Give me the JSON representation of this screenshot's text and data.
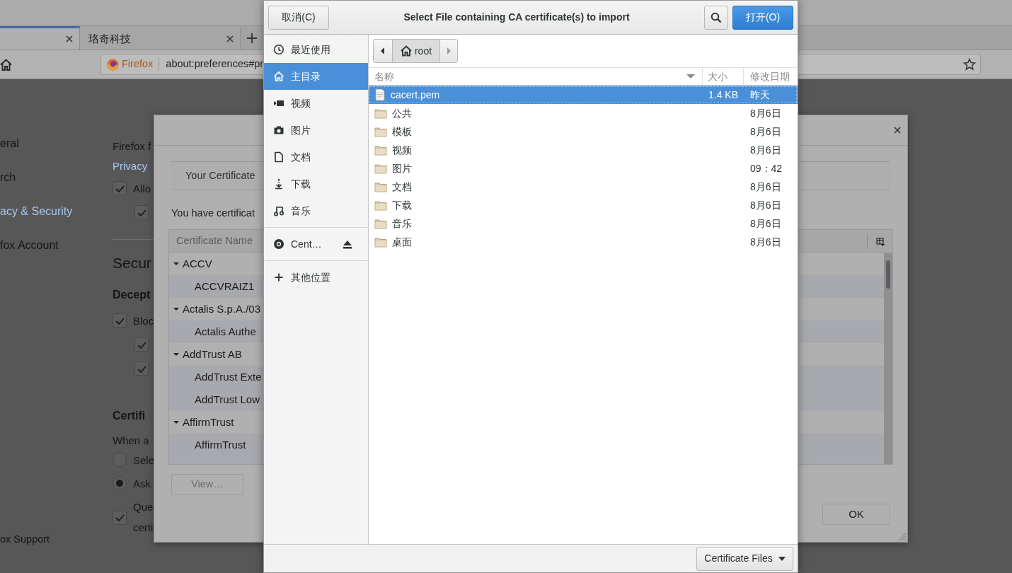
{
  "browser": {
    "tabs": [
      {
        "selected": true
      },
      {
        "label": "珞奇科技",
        "selected": false
      }
    ],
    "identity": "Firefox",
    "url": "about:preferences#pr"
  },
  "prefs_sidebar": [
    {
      "label": "eral",
      "selected": false
    },
    {
      "label": "rch",
      "selected": false
    },
    {
      "label": "acy & Security",
      "selected": true
    },
    {
      "label": "fox Account",
      "selected": false
    }
  ],
  "support_link": "ox Support",
  "prefs_content": [
    {
      "kind": "text",
      "text": "Firefox f"
    },
    {
      "kind": "link",
      "text": "Privacy"
    },
    {
      "kind": "check",
      "text": "Allo",
      "checked": true
    },
    {
      "kind": "subcheck",
      "checked": true
    },
    {
      "kind": "rule"
    },
    {
      "kind": "heading",
      "text": "Secur"
    },
    {
      "kind": "subheading",
      "text": "Decept"
    },
    {
      "kind": "check",
      "text": "Bloc",
      "checked": true
    },
    {
      "kind": "subcheck",
      "checked": true
    },
    {
      "kind": "subcheck",
      "checked": true
    },
    {
      "kind": "subheading",
      "text": "Certifi"
    },
    {
      "kind": "text",
      "text": "When a"
    },
    {
      "kind": "radio",
      "text": "Sele",
      "selected": false
    },
    {
      "kind": "radio",
      "text": "Ask",
      "selected": true
    },
    {
      "kind": "check2",
      "text": "Que",
      "text2": "certi",
      "checked": true
    }
  ],
  "cert_manager": {
    "tab": "Your Certificate",
    "description": "You have certificat",
    "column": "Certificate Name",
    "rows": [
      {
        "kind": "group",
        "label": "ACCV",
        "expanded": true
      },
      {
        "kind": "item",
        "label": "ACCVRAIZ1"
      },
      {
        "kind": "group",
        "label": "Actalis S.p.A./03",
        "expanded": true
      },
      {
        "kind": "item",
        "label": "Actalis Authe"
      },
      {
        "kind": "group",
        "label": "AddTrust AB",
        "expanded": true
      },
      {
        "kind": "item",
        "label": "AddTrust Exte"
      },
      {
        "kind": "item",
        "label": "AddTrust Low"
      },
      {
        "kind": "group",
        "label": "AffirmTrust",
        "expanded": true
      },
      {
        "kind": "item",
        "label": "AffirmTrust"
      }
    ],
    "view_button": "View…",
    "ok_button": "OK"
  },
  "file_chooser": {
    "cancel": "取消(C)",
    "title": "Select File containing CA certificate(s) to import",
    "open": "打开(O)",
    "places": [
      {
        "label": "最近使用",
        "selected": false
      },
      {
        "label": "主目录",
        "selected": true
      },
      {
        "label": "视频",
        "selected": false
      },
      {
        "label": "图片",
        "selected": false
      },
      {
        "label": "文档",
        "selected": false
      },
      {
        "label": "下载",
        "selected": false
      },
      {
        "label": "音乐",
        "selected": false
      }
    ],
    "device": "Cent…",
    "other_locations": "其他位置",
    "path": "root",
    "columns": [
      "名称",
      "大小",
      "修改日期"
    ],
    "files": [
      {
        "kind": "file",
        "name": "cacert.pem",
        "size": "1.4 KB",
        "modified": "昨天",
        "selected": true
      },
      {
        "kind": "folder",
        "name": "公共",
        "modified": "8月6日",
        "selected": false
      },
      {
        "kind": "folder",
        "name": "模板",
        "modified": "8月6日",
        "selected": false
      },
      {
        "kind": "folder",
        "name": "视频",
        "modified": "8月6日",
        "selected": false
      },
      {
        "kind": "folder",
        "name": "图片",
        "modified": "09：42",
        "selected": false
      },
      {
        "kind": "folder",
        "name": "文档",
        "modified": "8月6日",
        "selected": false
      },
      {
        "kind": "folder",
        "name": "下载",
        "modified": "8月6日",
        "selected": false
      },
      {
        "kind": "folder",
        "name": "音乐",
        "modified": "8月6日",
        "selected": false
      },
      {
        "kind": "folder",
        "name": "桌面",
        "modified": "8月6日",
        "selected": false
      }
    ],
    "filter": "Certificate Files"
  }
}
